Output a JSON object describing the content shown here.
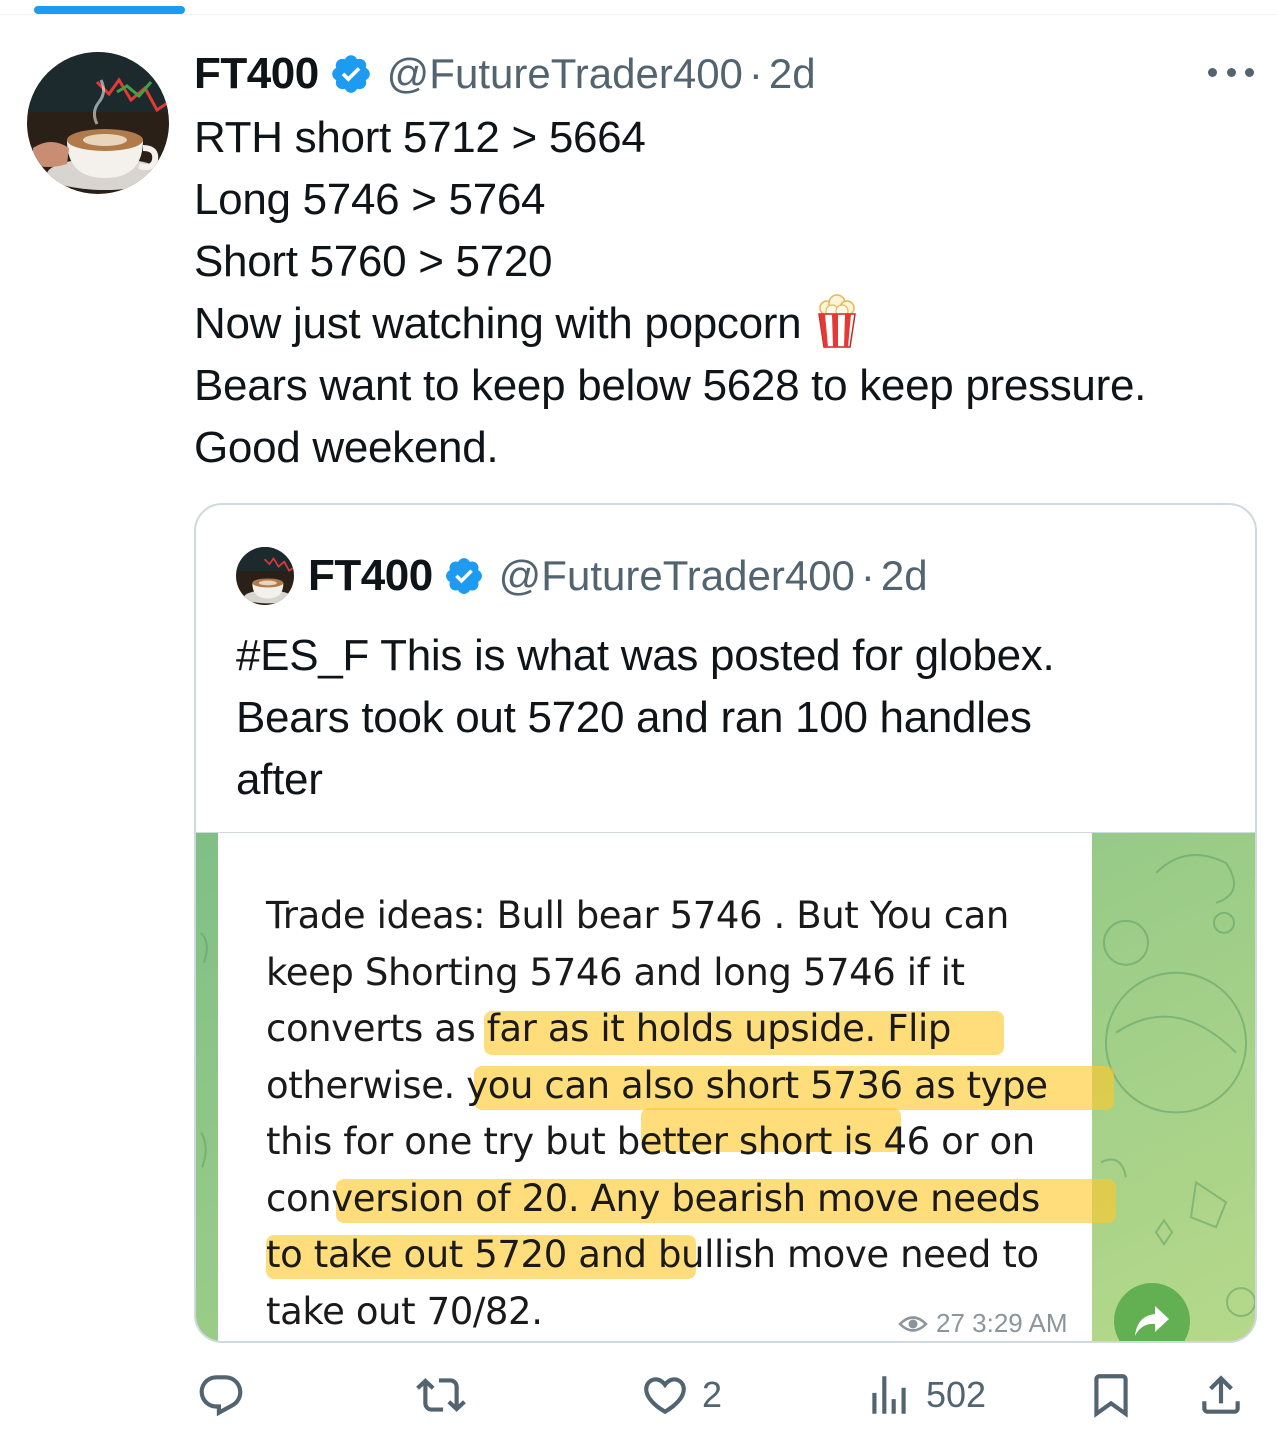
{
  "tweet": {
    "author": {
      "name": "FT400",
      "handle": "@FutureTrader400",
      "time": "2d"
    },
    "text_lines": [
      "RTH short 5712 > 5664",
      "Long 5746 > 5764",
      "Short 5760 > 5720",
      "Now just watching with popcorn",
      "Bears want to keep below 5628 to keep pressure.",
      "Good weekend."
    ],
    "emoji": "popcorn-icon"
  },
  "quoted": {
    "author": {
      "name": "FT400",
      "handle": "@FutureTrader400",
      "time": "2d"
    },
    "text_lines": [
      "#ES_F This is what was posted for globex.",
      "Bears took out 5720 and ran 100 handles",
      "after"
    ],
    "media": {
      "message_lines": [
        "Trade ideas: Bull bear 5746 . But You can",
        "keep Shorting 5746 and long 5746 if it",
        "converts as far as it holds upside. Flip",
        "otherwise. you can also short 5736 as type",
        "this for one try but better short is 46 or on",
        "conversion of 20. Any bearish move needs",
        "to take out 5720 and bullish move need to",
        "take out 70/82."
      ],
      "views": "27",
      "time": "3:29 AM",
      "background_color": "#a8cf8e",
      "highlight_color": "#ffc828"
    }
  },
  "actions": {
    "reply": {
      "icon": "reply-icon",
      "count": ""
    },
    "repost": {
      "icon": "repost-icon",
      "count": ""
    },
    "like": {
      "icon": "heart-icon",
      "count": "2"
    },
    "views": {
      "icon": "views-icon",
      "count": "502"
    },
    "bookmark": {
      "icon": "bookmark-icon"
    },
    "share": {
      "icon": "share-icon"
    }
  },
  "colors": {
    "accent": "#1d9bf0",
    "secondary_text": "#536471",
    "border": "#cfd9de"
  }
}
